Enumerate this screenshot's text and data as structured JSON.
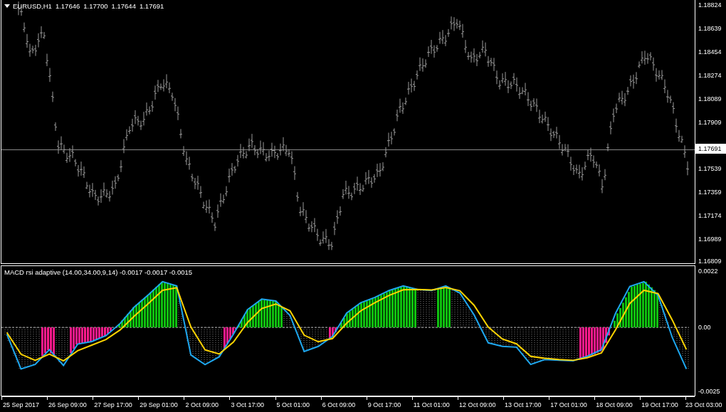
{
  "price_chart": {
    "symbol": "EURUSD,H1",
    "ohlc": [
      "1.17646",
      "1.17700",
      "1.17644",
      "1.17691"
    ],
    "upper_ticks": [
      "1.18824",
      "1.18639",
      "1.18454",
      "1.18274",
      "1.18089",
      "1.17909"
    ],
    "current_price": "1.17691",
    "lower_ticks": [
      "1.17539",
      "1.17359",
      "1.17174",
      "1.16989",
      "1.16809"
    ]
  },
  "indicator": {
    "title": "MACD rsi adaptive (14.00,34.00,9,14) -0.0017 -0.0017 -0.0015",
    "chart_data": {
      "type": "line",
      "ylim": [
        -0.0027,
        0.0024
      ],
      "yticks": [
        {
          "value": 0.0022,
          "label": "0.0022"
        },
        {
          "value": 0,
          "label": "0.00"
        },
        {
          "value": -0.0025,
          "label": "-0.0025"
        }
      ],
      "series": [
        {
          "color": "#1ea8f0",
          "values": [
            -0.00028,
            -0.00165,
            -0.00147,
            -0.00089,
            -0.00151,
            -0.00067,
            -0.00057,
            -0.00034,
            0.00014,
            0.00079,
            0.00127,
            0.00179,
            0.00162,
            -0.0011,
            -0.00148,
            -0.00117,
            -0.00028,
            0.00069,
            0.0011,
            0.00103,
            0.00046,
            -0.00096,
            -0.00076,
            -0.00037,
            0.00055,
            0.00096,
            0.00117,
            0.00144,
            0.00162,
            0.00148,
            0.00144,
            0.00162,
            0.00134,
            0.00048,
            -0.00062,
            -0.00076,
            -0.00079,
            -0.00147,
            -0.00128,
            -0.00131,
            -0.00133,
            -0.00115,
            -0.00089,
            0.00055,
            0.0016,
            0.00179,
            0.00124,
            -0.00041,
            -0.00165
          ]
        },
        {
          "color": "#ffd400",
          "values": [
            -0.00021,
            -0.00107,
            -0.00131,
            -0.00106,
            -0.00133,
            -0.00093,
            -0.00071,
            -0.00049,
            -0.00011,
            0.00043,
            0.00093,
            0.00145,
            0.00155,
            0,
            -0.0009,
            -0.00106,
            -0.00059,
            0.00018,
            0.00073,
            0.00091,
            0.00064,
            -0.00032,
            -0.00058,
            -0.00045,
            0.00015,
            0.00064,
            0.00096,
            0.00125,
            0.00147,
            0.00148,
            0.00146,
            0.00156,
            0.00143,
            0.00086,
            0,
            -0.00047,
            -0.00066,
            -0.00115,
            -0.00123,
            -0.00128,
            -0.00131,
            -0.00121,
            -0.00102,
            -0.0001,
            0.00093,
            0.00145,
            0.00132,
            0.00028,
            -0.00088
          ]
        }
      ]
    }
  },
  "time_axis": [
    "25 Sep 2017",
    "26 Sep 09:00",
    "27 Sep 17:00",
    "29 Sep 01:00",
    "2 Oct 09:00",
    "3 Oct 17:00",
    "5 Oct 01:00",
    "6 Oct 09:00",
    "9 Oct 17:00",
    "11 Oct 01:00",
    "12 Oct 09:00",
    "13 Oct 17:00",
    "17 Oct 01:00",
    "18 Oct 09:00",
    "19 Oct 17:00",
    "23 Oct 03:00"
  ]
}
